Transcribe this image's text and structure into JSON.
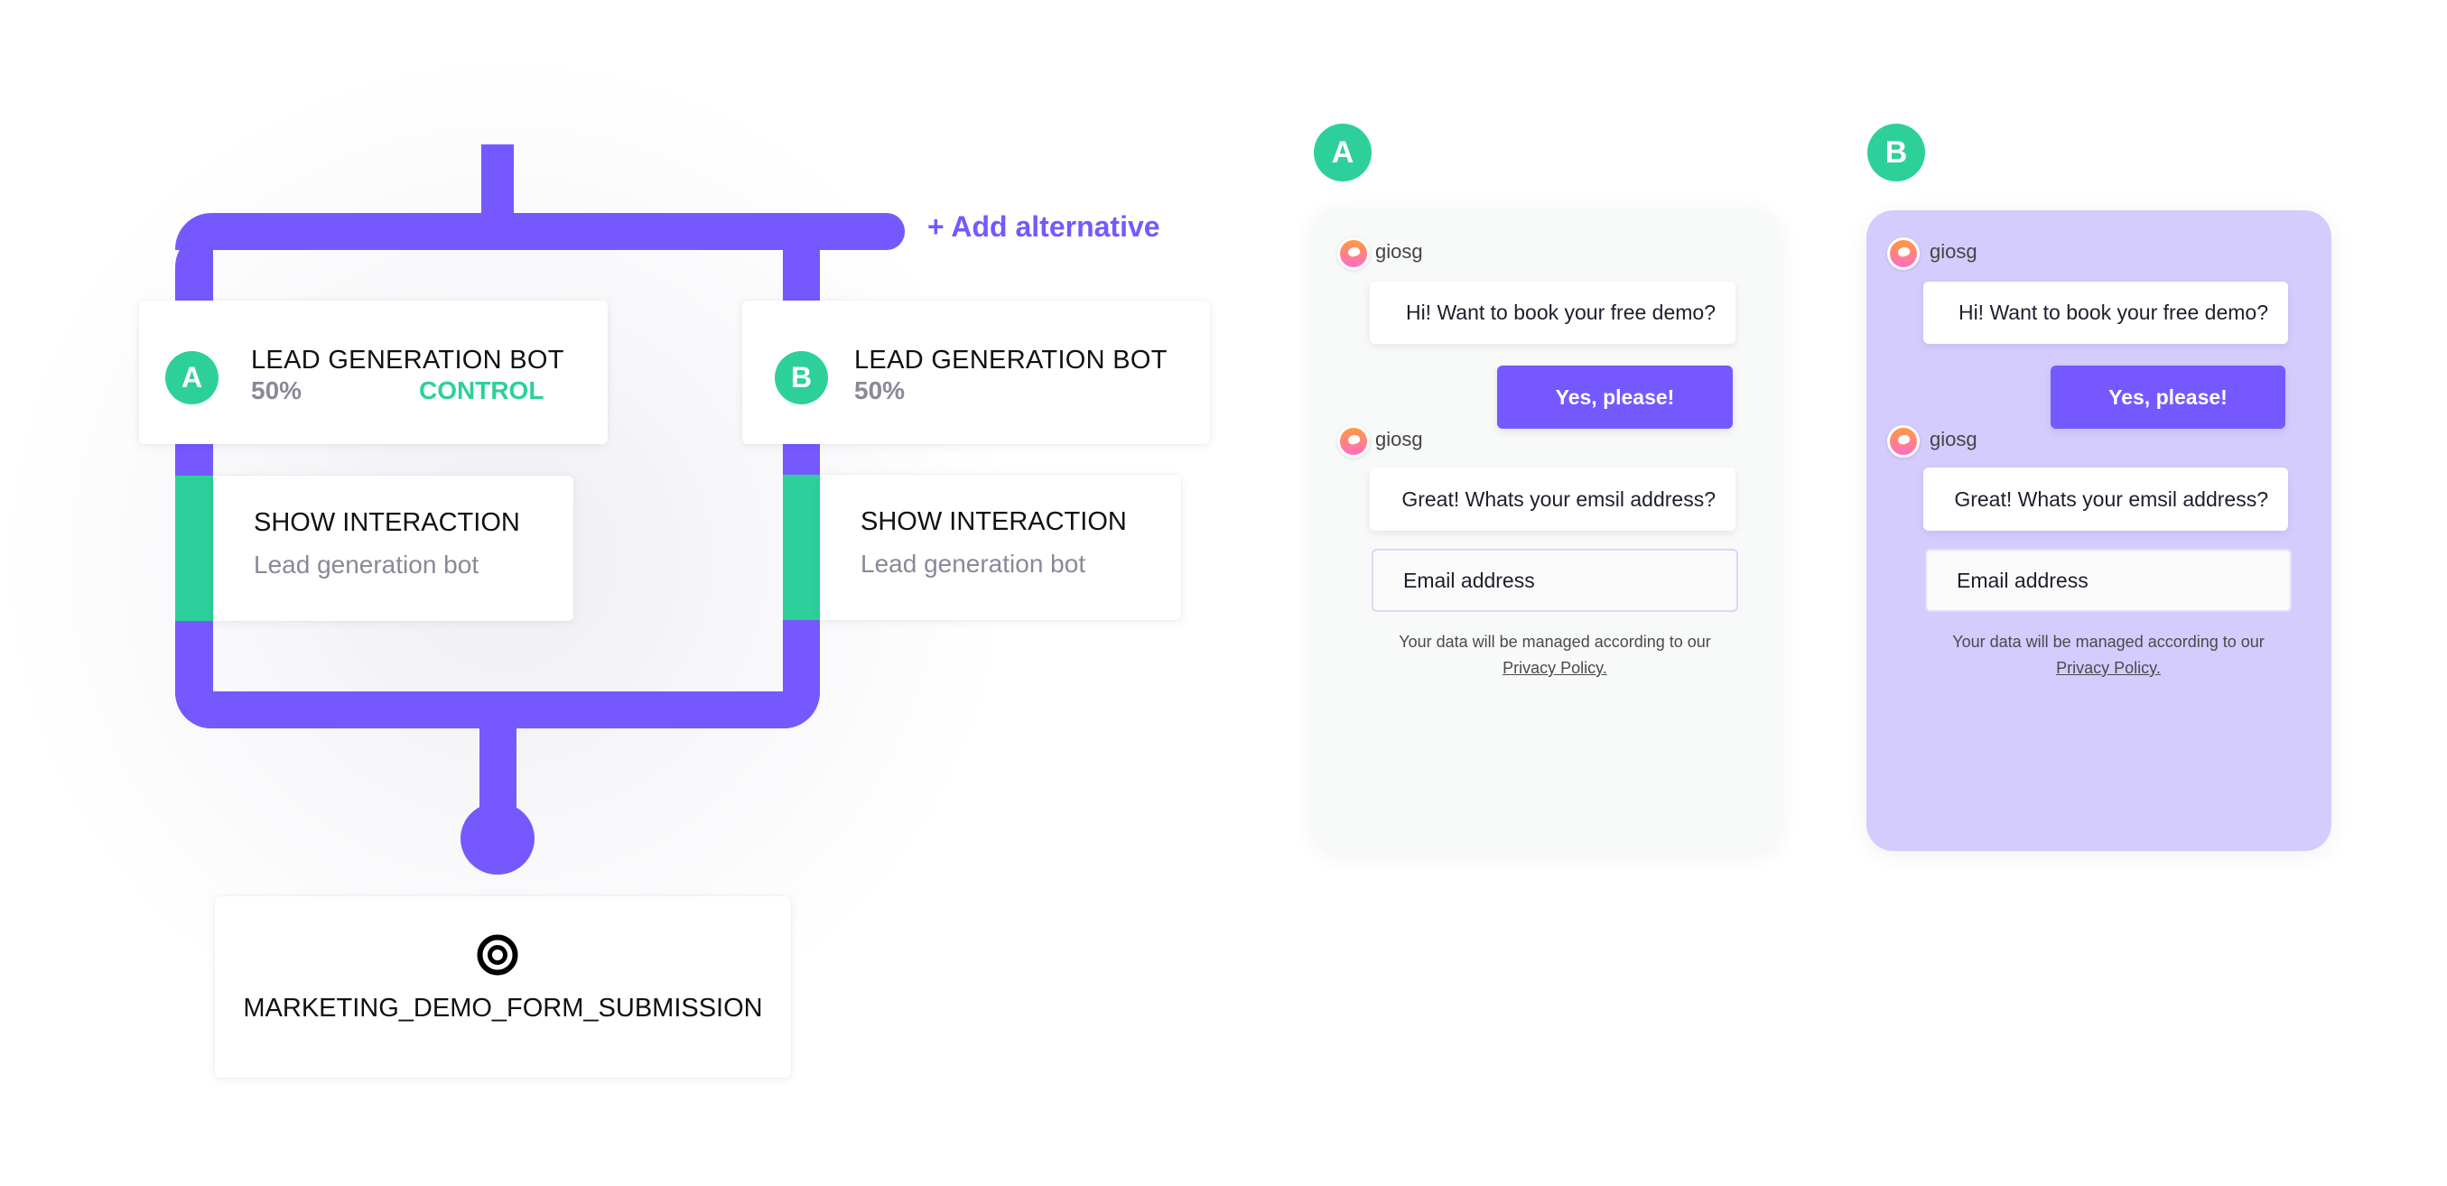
{
  "colors": {
    "accent_purple": "#7559fe",
    "accent_green": "#2dd09b",
    "panel_b_background": "#d4ccfd",
    "panel_a_background": "#f8f9f9"
  },
  "flow": {
    "add_alternative_label": "+ Add alternative",
    "variants": [
      {
        "badge": "A",
        "title": "LEAD GENERATION BOT",
        "split": "50%",
        "tag": "CONTROL",
        "action": {
          "title": "SHOW INTERACTION",
          "subtitle": "Lead generation bot"
        }
      },
      {
        "badge": "B",
        "title": "LEAD GENERATION BOT",
        "split": "50%",
        "tag": "",
        "action": {
          "title": "SHOW INTERACTION",
          "subtitle": "Lead generation bot"
        }
      }
    ],
    "goal": {
      "icon": "target-icon",
      "label": "MARKETING_DEMO_FORM_SUBMISSION"
    }
  },
  "previews": [
    {
      "badge": "A",
      "messages": [
        {
          "sender": "giosg",
          "text": "Hi! Want to book your free demo?"
        },
        {
          "sender": "giosg",
          "text": "Great! Whats your emsil address?"
        }
      ],
      "reply_button": "Yes, please!",
      "email_placeholder": "Email address",
      "privacy_text": "Your data will be managed according to our",
      "privacy_link": "Privacy Policy."
    },
    {
      "badge": "B",
      "messages": [
        {
          "sender": "giosg",
          "text": "Hi! Want to book your free demo?"
        },
        {
          "sender": "giosg",
          "text": "Great! Whats your emsil address?"
        }
      ],
      "reply_button": "Yes, please!",
      "email_placeholder": "Email address",
      "privacy_text": "Your data will be managed according to our",
      "privacy_link": "Privacy Policy."
    }
  ]
}
